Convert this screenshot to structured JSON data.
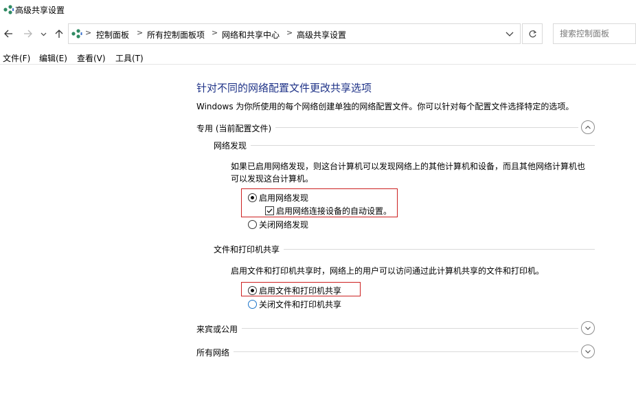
{
  "window": {
    "title": "高级共享设置"
  },
  "nav": {
    "back_icon": "arrow-left-icon",
    "forward_icon": "arrow-right-icon",
    "recent_icon": "chevron-down-icon",
    "up_icon": "arrow-up-icon",
    "breadcrumbs": [
      "控制面板",
      "所有控制面板项",
      "网络和共享中心",
      "高级共享设置"
    ],
    "search_placeholder": "搜索控制面板"
  },
  "menu": [
    "文件(F)",
    "编辑(E)",
    "查看(V)",
    "工具(T)"
  ],
  "page": {
    "title": "针对不同的网络配置文件更改共享选项",
    "description": "Windows 为你所使用的每个网络创建单独的网络配置文件。你可以针对每个配置文件选择特定的选项。"
  },
  "profiles": {
    "private": {
      "label": "专用 (当前配置文件)",
      "expanded": true,
      "network_discovery": {
        "label": "网络发现",
        "description_line1": "如果已启用网络发现，则这台计算机可以发现网络上的其他计算机和设备，而且其他网络计算机也",
        "description_line2": "可以发现这台计算机。",
        "on_label": "启用网络发现",
        "auto_setup_label": "启用网络连接设备的自动设置。",
        "off_label": "关闭网络发现",
        "selected": "on",
        "auto_setup_checked": true
      },
      "file_sharing": {
        "label": "文件和打印机共享",
        "description": "启用文件和打印机共享时，网络上的用户可以访问通过此计算机共享的文件和打印机。",
        "on_label": "启用文件和打印机共享",
        "off_label": "关闭文件和打印机共享",
        "selected": "on"
      }
    },
    "guest_public": {
      "label": "来宾或公用",
      "expanded": false
    },
    "all_networks": {
      "label": "所有网络",
      "expanded": false
    }
  },
  "colors": {
    "title_blue": "#1e3287",
    "highlight_red": "#cc1f1f",
    "radio_blue": "#1a73c9"
  }
}
